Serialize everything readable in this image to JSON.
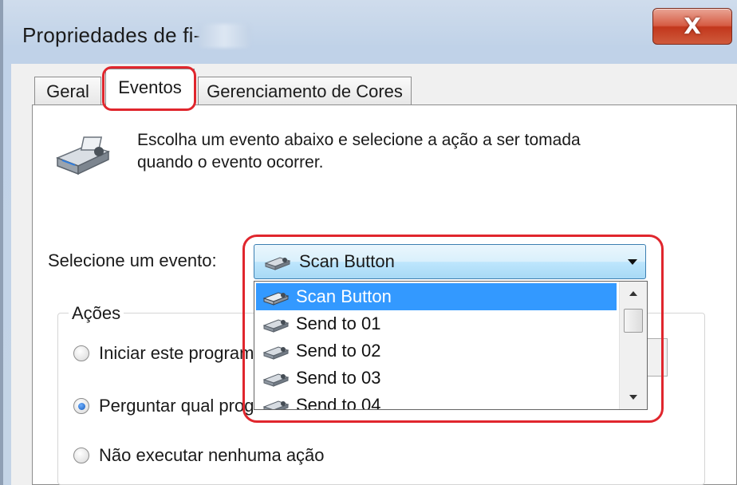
{
  "window": {
    "title": "Propriedades de fi-",
    "close_label": "X"
  },
  "tabs": [
    {
      "label": "Geral"
    },
    {
      "label": "Eventos"
    },
    {
      "label": "Gerenciamento de Cores"
    }
  ],
  "active_tab": "Eventos",
  "description": {
    "line1": "Escolha um evento abaixo e selecione a ação a ser tomada",
    "line2": "quando o evento ocorrer."
  },
  "event_select": {
    "label": "Selecione um evento:",
    "selected": "Scan Button",
    "options": [
      "Scan Button",
      "Send to 01",
      "Send to 02",
      "Send to 03",
      "Send to 04"
    ]
  },
  "actions": {
    "title": "Ações",
    "options": [
      {
        "label": "Iniciar este program",
        "checked": false
      },
      {
        "label": "Perguntar qual prog",
        "checked": true
      },
      {
        "label": "Não executar nenhuma ação",
        "checked": false
      }
    ]
  },
  "colors": {
    "highlight": "#e0262d",
    "selection": "#3399ff",
    "close_button": "#c2371c"
  },
  "icons": {
    "device": "scanner-icon",
    "option": "scanner-icon"
  }
}
